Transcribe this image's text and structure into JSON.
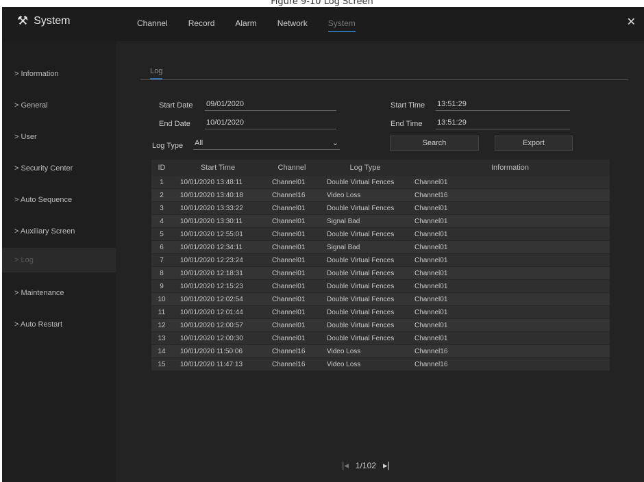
{
  "caption": "Figure 9-10 Log Screen",
  "header": {
    "brand": "System",
    "tabs": [
      {
        "label": "Channel"
      },
      {
        "label": "Record"
      },
      {
        "label": "Alarm"
      },
      {
        "label": "Network"
      },
      {
        "label": "System",
        "active": true
      }
    ],
    "close_icon": "close-icon"
  },
  "sidebar": {
    "items": [
      {
        "label": "> Information"
      },
      {
        "label": "> General"
      },
      {
        "label": "> User"
      },
      {
        "label": "> Security Center"
      },
      {
        "label": "> Auto Sequence"
      },
      {
        "label": "> Auxiliary Screen"
      },
      {
        "label": "> Log",
        "active": true
      },
      {
        "label": "> Maintenance"
      },
      {
        "label": "> Auto Restart"
      }
    ]
  },
  "main": {
    "subtab": "Log",
    "form": {
      "start_date_label": "Start Date",
      "start_date": "09/01/2020",
      "end_date_label": "End Date",
      "end_date": "10/01/2020",
      "start_time_label": "Start Time",
      "start_time": "13:51:29",
      "end_time_label": "End Time",
      "end_time": "13:51:29",
      "log_type_label": "Log Type",
      "log_type": "All",
      "search_label": "Search",
      "export_label": "Export"
    },
    "table": {
      "headers": {
        "id": "ID",
        "start_time": "Start Time",
        "channel": "Channel",
        "log_type": "Log Type",
        "information": "Information"
      },
      "rows": [
        {
          "id": "1",
          "time": "10/01/2020 13:48:11",
          "channel": "Channel01",
          "type": "Double Virtual Fences",
          "info": "Channel01"
        },
        {
          "id": "2",
          "time": "10/01/2020 13:40:18",
          "channel": "Channel16",
          "type": "Video Loss",
          "info": "Channel16"
        },
        {
          "id": "3",
          "time": "10/01/2020 13:33:22",
          "channel": "Channel01",
          "type": "Double Virtual Fences",
          "info": "Channel01"
        },
        {
          "id": "4",
          "time": "10/01/2020 13:30:11",
          "channel": "Channel01",
          "type": "Signal Bad",
          "info": "Channel01"
        },
        {
          "id": "5",
          "time": "10/01/2020 12:55:01",
          "channel": "Channel01",
          "type": "Double Virtual Fences",
          "info": "Channel01"
        },
        {
          "id": "6",
          "time": "10/01/2020 12:34:11",
          "channel": "Channel01",
          "type": "Signal Bad",
          "info": "Channel01"
        },
        {
          "id": "7",
          "time": "10/01/2020 12:23:24",
          "channel": "Channel01",
          "type": "Double Virtual Fences",
          "info": "Channel01"
        },
        {
          "id": "8",
          "time": "10/01/2020 12:18:31",
          "channel": "Channel01",
          "type": "Double Virtual Fences",
          "info": "Channel01"
        },
        {
          "id": "9",
          "time": "10/01/2020 12:15:23",
          "channel": "Channel01",
          "type": "Double Virtual Fences",
          "info": "Channel01"
        },
        {
          "id": "10",
          "time": "10/01/2020 12:02:54",
          "channel": "Channel01",
          "type": "Double Virtual Fences",
          "info": "Channel01"
        },
        {
          "id": "11",
          "time": "10/01/2020 12:01:44",
          "channel": "Channel01",
          "type": "Double Virtual Fences",
          "info": "Channel01"
        },
        {
          "id": "12",
          "time": "10/01/2020 12:00:57",
          "channel": "Channel01",
          "type": "Double Virtual Fences",
          "info": "Channel01"
        },
        {
          "id": "13",
          "time": "10/01/2020 12:00:30",
          "channel": "Channel01",
          "type": "Double Virtual Fences",
          "info": "Channel01"
        },
        {
          "id": "14",
          "time": "10/01/2020 11:50:06",
          "channel": "Channel16",
          "type": "Video Loss",
          "info": "Channel16"
        },
        {
          "id": "15",
          "time": "10/01/2020 11:47:13",
          "channel": "Channel16",
          "type": "Video Loss",
          "info": "Channel16"
        }
      ]
    },
    "pager": {
      "prev_icon": "prev-page-icon",
      "page": "1/102",
      "last_icon": "last-page-icon"
    }
  },
  "colors": {
    "background": "#232323",
    "accent": "#2f6fa8"
  }
}
